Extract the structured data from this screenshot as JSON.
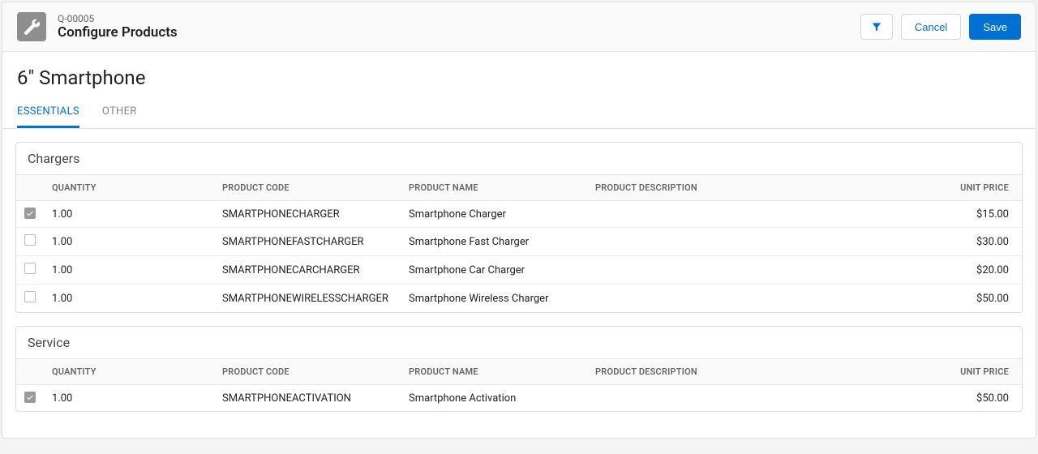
{
  "header": {
    "quote_id": "Q-00005",
    "page_title": "Configure Products",
    "filter_icon": "filter-icon",
    "cancel_label": "Cancel",
    "save_label": "Save"
  },
  "product_title": "6\" Smartphone",
  "tabs": [
    {
      "label": "ESSENTIALS",
      "active": true
    },
    {
      "label": "OTHER",
      "active": false
    }
  ],
  "columns": {
    "quantity": "QUANTITY",
    "product_code": "PRODUCT CODE",
    "product_name": "PRODUCT NAME",
    "product_description": "PRODUCT DESCRIPTION",
    "unit_price": "UNIT PRICE"
  },
  "groups": [
    {
      "title": "Chargers",
      "rows": [
        {
          "checked": true,
          "quantity": "1.00",
          "code": "SMARTPHONECHARGER",
          "name": "Smartphone Charger",
          "description": "",
          "price": "$15.00"
        },
        {
          "checked": false,
          "quantity": "1.00",
          "code": "SMARTPHONEFASTCHARGER",
          "name": "Smartphone Fast Charger",
          "description": "",
          "price": "$30.00"
        },
        {
          "checked": false,
          "quantity": "1.00",
          "code": "SMARTPHONECARCHARGER",
          "name": "Smartphone Car Charger",
          "description": "",
          "price": "$20.00"
        },
        {
          "checked": false,
          "quantity": "1.00",
          "code": "SMARTPHONEWIRELESSCHARGER",
          "name": "Smartphone Wireless Charger",
          "description": "",
          "price": "$50.00"
        }
      ]
    },
    {
      "title": "Service",
      "rows": [
        {
          "checked": true,
          "quantity": "1.00",
          "code": "SMARTPHONEACTIVATION",
          "name": "Smartphone Activation",
          "description": "",
          "price": "$50.00"
        }
      ]
    }
  ]
}
